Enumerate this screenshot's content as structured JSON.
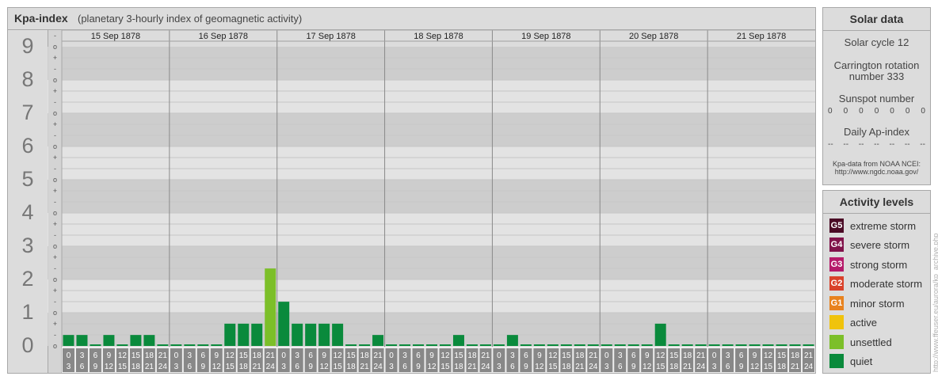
{
  "header": {
    "title": "Kpa-index",
    "subtitle": "(planetary 3-hourly index of geomagnetic activity)"
  },
  "chart_data": {
    "type": "bar",
    "title": "Kpa-index",
    "subtitle": "(planetary 3-hourly index of geomagnetic activity)",
    "ylim": [
      0,
      9
    ],
    "y_ticks": [
      "0",
      "1",
      "2",
      "3",
      "4",
      "5",
      "6",
      "7",
      "8",
      "9"
    ],
    "y_subticks": [
      "-",
      "o",
      "+"
    ],
    "days": [
      "15 Sep 1878",
      "16 Sep 1878",
      "17 Sep 1878",
      "18 Sep 1878",
      "19 Sep 1878",
      "20 Sep 1878",
      "21 Sep 1878"
    ],
    "hour_labels": [
      [
        "0",
        "3"
      ],
      [
        "3",
        "6"
      ],
      [
        "6",
        "9"
      ],
      [
        "9",
        "12"
      ],
      [
        "12",
        "15"
      ],
      [
        "15",
        "18"
      ],
      [
        "18",
        "21"
      ],
      [
        "21",
        "24"
      ]
    ],
    "values": [
      0.33,
      0.33,
      0,
      0.33,
      0,
      0.33,
      0.33,
      0,
      0,
      0,
      0,
      0,
      0.67,
      0.67,
      0.67,
      2.33,
      1.33,
      0.67,
      0.67,
      0.67,
      0.67,
      0,
      0,
      0.33,
      0,
      0,
      0,
      0,
      0,
      0.33,
      0,
      0,
      0,
      0.33,
      0,
      0,
      0,
      0,
      0,
      0,
      0,
      0,
      0,
      0,
      0.67,
      0,
      0,
      0,
      0,
      0,
      0,
      0,
      0,
      0,
      0,
      0
    ],
    "legend_placement": "right"
  },
  "solar": {
    "title": "Solar data",
    "cycle": "Solar cycle 12",
    "carrington_line1": "Carrington rotation",
    "carrington_line2": "number 333",
    "sunspot_label": "Sunspot number",
    "sunspot_values": [
      "0",
      "0",
      "0",
      "0",
      "0",
      "0",
      "0"
    ],
    "ap_label": "Daily Ap-index",
    "ap_values": [
      "--",
      "--",
      "--",
      "--",
      "--",
      "--",
      "--"
    ],
    "source_line1": "Kpa-data from NOAA NCEI:",
    "source_line2": "http://www.ngdc.noaa.gov/"
  },
  "activity": {
    "title": "Activity levels",
    "levels": [
      {
        "code": "G5",
        "label": "extreme storm",
        "color": "#4a0a25"
      },
      {
        "code": "G4",
        "label": "severe storm",
        "color": "#80124a"
      },
      {
        "code": "G3",
        "label": "strong storm",
        "color": "#b51a6a"
      },
      {
        "code": "G2",
        "label": "moderate storm",
        "color": "#d9412a"
      },
      {
        "code": "G1",
        "label": "minor storm",
        "color": "#e8821e"
      },
      {
        "code": "",
        "label": "active",
        "color": "#f0c30c"
      },
      {
        "code": "",
        "label": "unsettled",
        "color": "#7cbf29"
      },
      {
        "code": "",
        "label": "quiet",
        "color": "#0a8a3c"
      }
    ]
  },
  "colors": {
    "quiet": "#0a8a3c",
    "unsettled": "#7cbf29",
    "active": "#f0c30c",
    "band_dark": "#cdcdcd",
    "band_light": "#e3e3e3",
    "hour_label_bg": "#888888"
  },
  "watermark": "http://www.ffeuser.eu/aurora/kp_archive.php"
}
